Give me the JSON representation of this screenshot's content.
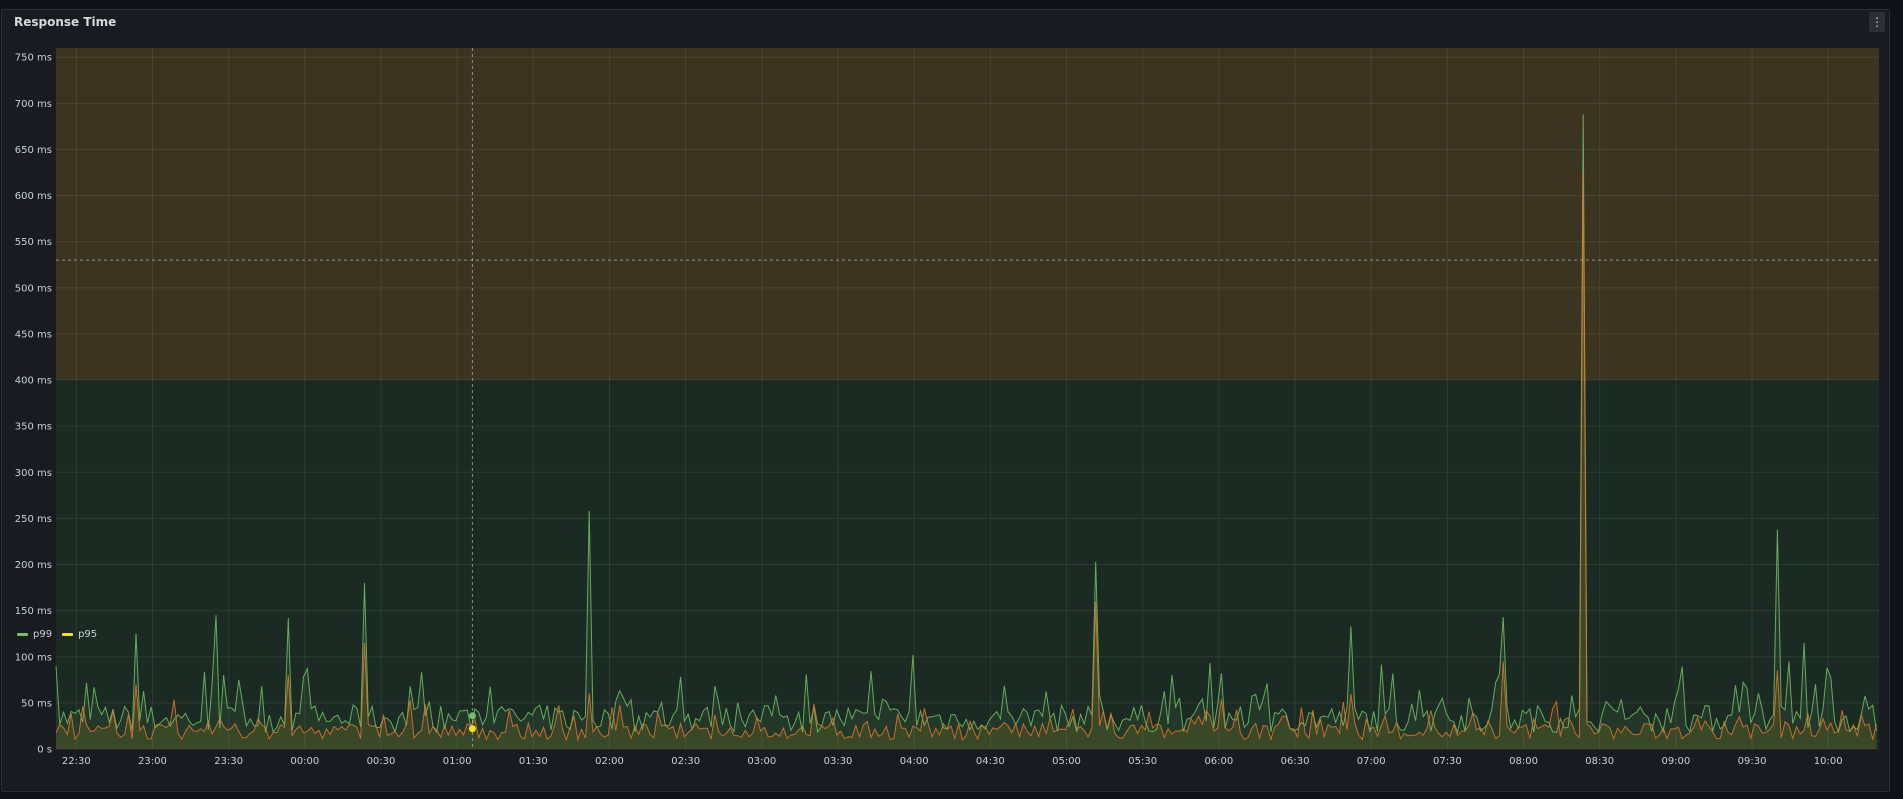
{
  "panel": {
    "title": "Response Time",
    "menu_icon": "kebab-menu-icon"
  },
  "colors": {
    "background": "#181b1f",
    "threshold_warning": "#3a3420",
    "threshold_ok": "#1b2a22",
    "p99": "#73bf69",
    "p95": "#fade2a",
    "p95_line": "#e0752d"
  },
  "legend": [
    {
      "name": "p99",
      "color": "#73bf69"
    },
    {
      "name": "p95",
      "color": "#fade2a"
    }
  ],
  "chart_data": {
    "type": "line",
    "title": "Response Time",
    "xlabel": "",
    "ylabel": "",
    "ylim": [
      0,
      760
    ],
    "x_range": [
      "22:22",
      "10:20"
    ],
    "y_ticks": [
      "0 s",
      "50 ms",
      "100 ms",
      "150 ms",
      "200 ms",
      "250 ms",
      "300 ms",
      "350 ms",
      "400 ms",
      "450 ms",
      "500 ms",
      "550 ms",
      "600 ms",
      "650 ms",
      "700 ms",
      "750 ms"
    ],
    "x_ticks": [
      "22:30",
      "23:00",
      "23:30",
      "00:00",
      "00:30",
      "01:00",
      "01:30",
      "02:00",
      "02:30",
      "03:00",
      "03:30",
      "04:00",
      "04:30",
      "05:00",
      "05:30",
      "06:00",
      "06:30",
      "07:00",
      "07:30",
      "08:00",
      "08:30",
      "09:00",
      "09:30",
      "10:00"
    ],
    "grid": true,
    "legend_position": "bottom-left",
    "thresholds": [
      {
        "from": 0,
        "to": 400,
        "level": "ok"
      },
      {
        "from": 400,
        "to": 760,
        "level": "warning"
      }
    ],
    "threshold_line": 530,
    "crosshair_time": "01:06",
    "baseline_ms": 25,
    "series": [
      {
        "name": "p99",
        "peaks": [
          {
            "t": "22:22",
            "v": 90
          },
          {
            "t": "22:53",
            "v": 125
          },
          {
            "t": "23:25",
            "v": 145
          },
          {
            "t": "23:34",
            "v": 75
          },
          {
            "t": "23:54",
            "v": 142
          },
          {
            "t": "00:24",
            "v": 180
          },
          {
            "t": "01:52",
            "v": 258
          },
          {
            "t": "04:00",
            "v": 102
          },
          {
            "t": "05:12",
            "v": 203
          },
          {
            "t": "05:57",
            "v": 93
          },
          {
            "t": "06:52",
            "v": 133
          },
          {
            "t": "07:52",
            "v": 143
          },
          {
            "t": "08:24",
            "v": 688
          },
          {
            "t": "09:45",
            "v": 95
          },
          {
            "t": "09:40",
            "v": 238
          },
          {
            "t": "09:50",
            "v": 115
          },
          {
            "t": "10:00",
            "v": 88
          }
        ]
      },
      {
        "name": "p95",
        "peaks": [
          {
            "t": "22:53",
            "v": 70
          },
          {
            "t": "23:54",
            "v": 80
          },
          {
            "t": "00:24",
            "v": 115
          },
          {
            "t": "01:52",
            "v": 60
          },
          {
            "t": "05:12",
            "v": 160
          },
          {
            "t": "07:52",
            "v": 95
          },
          {
            "t": "08:24",
            "v": 625
          },
          {
            "t": "09:40",
            "v": 85
          },
          {
            "t": "06:52",
            "v": 60
          }
        ]
      }
    ]
  }
}
